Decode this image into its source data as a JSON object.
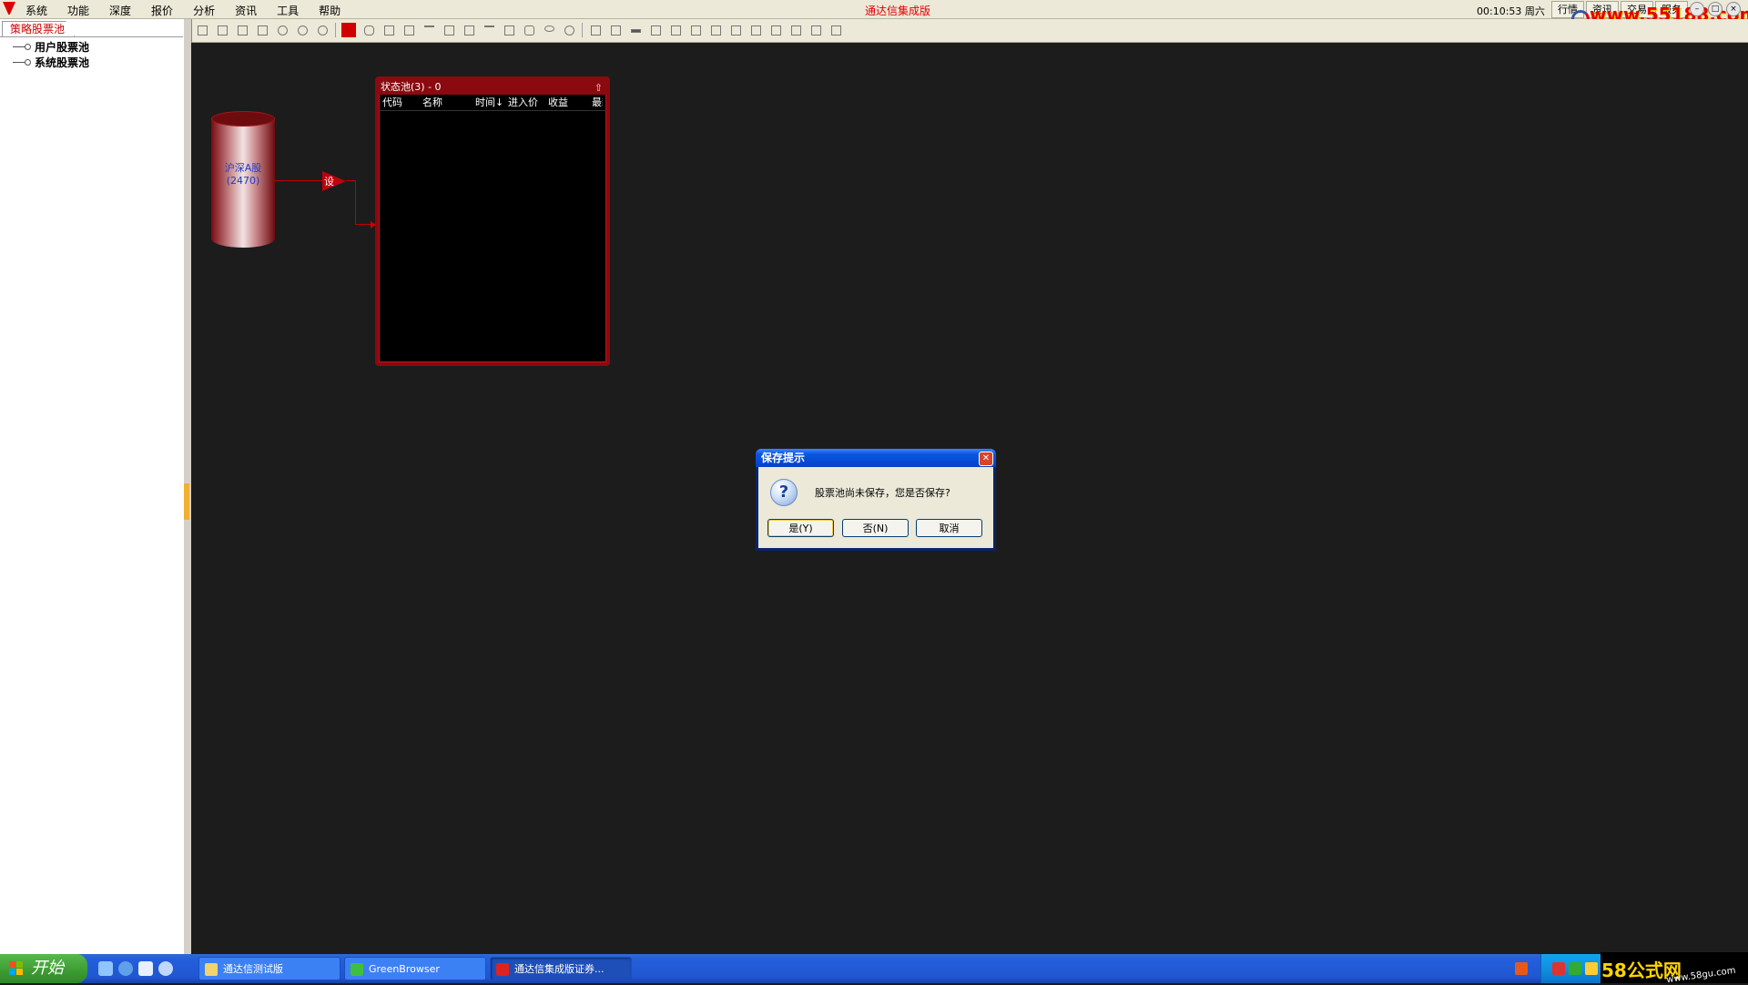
{
  "app": {
    "title": "通达信集成版",
    "menus": [
      "系统",
      "功能",
      "深度",
      "报价",
      "分析",
      "资讯",
      "工具",
      "帮助"
    ],
    "clock": "00:10:53 周六",
    "top_tabs": [
      "行情",
      "资讯",
      "交易",
      "服务"
    ],
    "watermark_top": "www.55188.com"
  },
  "left_panel": {
    "tab": "策略股票池",
    "tree": [
      "用户股票池",
      "系统股票池"
    ]
  },
  "canvas": {
    "source": {
      "name": "沪深A股",
      "count": "(2470)"
    },
    "setter_label": "设",
    "pool": {
      "title": "状态池(3) - 0",
      "pin_icon": "⇧",
      "columns": [
        "代码",
        "名称",
        "时间↓",
        "进入价",
        "收益",
        "最新"
      ]
    }
  },
  "dialog": {
    "title": "保存提示",
    "close": "✕",
    "icon": "?",
    "message": "股票池尚未保存，您是否保存?",
    "buttons": {
      "yes": "是(Y)",
      "no": "否(N)",
      "cancel": "取消"
    }
  },
  "taskbar": {
    "start": "开始",
    "tasks": [
      "通达信测试版",
      "GreenBrowser",
      "通达信集成版证券..."
    ],
    "watermark_bottom": {
      "brand": "58公式网",
      "url": "www.58gu.com"
    }
  },
  "colors": {
    "accent_red": "#c00000",
    "canvas_bg": "#1c1c1c",
    "xp_blue": "#245edb",
    "start_green": "#3c9b32"
  }
}
